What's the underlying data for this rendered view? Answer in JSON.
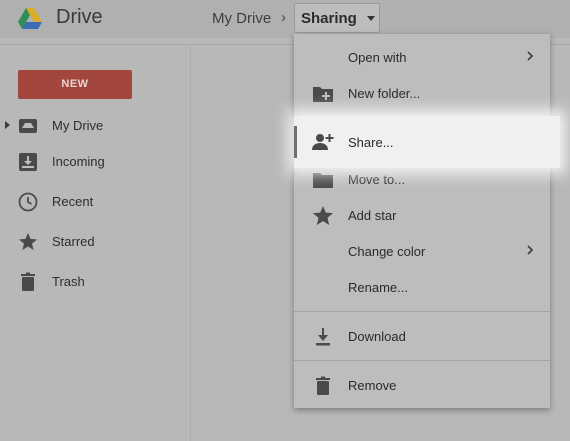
{
  "header": {
    "app_title": "Drive",
    "breadcrumb_root": "My Drive",
    "breadcrumb_separator": "›",
    "breadcrumb_current": "Sharing"
  },
  "sidebar": {
    "new_button": "NEW",
    "items": [
      {
        "label": "My Drive",
        "icon": "my-drive-icon"
      },
      {
        "label": "Incoming",
        "icon": "incoming-icon"
      },
      {
        "label": "Recent",
        "icon": "clock-icon"
      },
      {
        "label": "Starred",
        "icon": "star-icon"
      },
      {
        "label": "Trash",
        "icon": "trash-icon"
      }
    ]
  },
  "context_menu": {
    "items": [
      {
        "label": "Open with",
        "icon": "",
        "has_submenu": true
      },
      {
        "label": "New folder...",
        "icon": "new-folder-icon"
      },
      {
        "label": "Share...",
        "icon": "add-person-icon",
        "highlighted": true
      },
      {
        "label": "Move to...",
        "icon": "folder-icon"
      },
      {
        "label": "Add star",
        "icon": "star-icon"
      },
      {
        "label": "Change color",
        "icon": "",
        "has_submenu": true
      },
      {
        "label": "Rename...",
        "icon": ""
      },
      {
        "label": "Download",
        "icon": "download-icon"
      },
      {
        "label": "Remove",
        "icon": "trash-icon"
      }
    ]
  },
  "colors": {
    "new_button": "#a2463e",
    "logo_green": "#2f8f56",
    "logo_yellow": "#d9ad2a",
    "logo_blue": "#3b6fb5"
  }
}
